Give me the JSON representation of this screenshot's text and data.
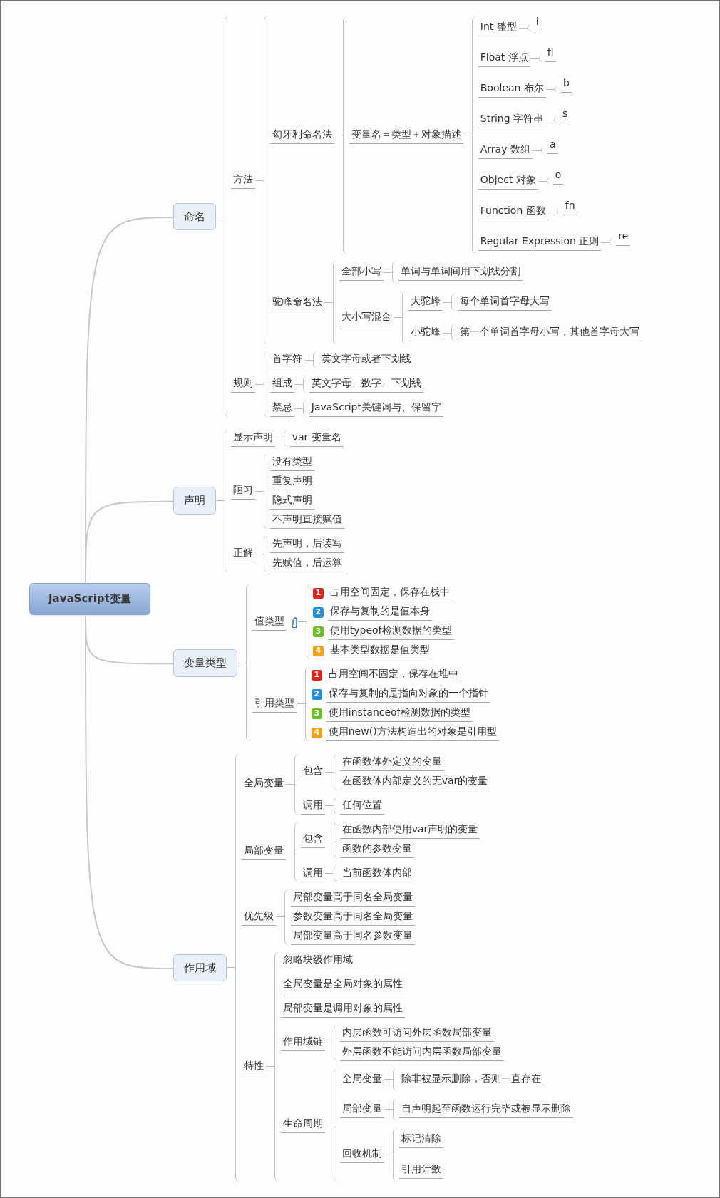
{
  "root": {
    "label": "JavaScript变量"
  },
  "main_topics": [
    {
      "label": "命名",
      "children": [
        {
          "label": "方法",
          "children": [
            {
              "label": "匈牙利命名法",
              "children": [
                {
                  "label": "变量名＝类型＋对象描述",
                  "children": [
                    {
                      "label": "Int 整型",
                      "children": [
                        {
                          "label": "i"
                        }
                      ]
                    },
                    {
                      "label": "Float 浮点",
                      "children": [
                        {
                          "label": "fl"
                        }
                      ]
                    },
                    {
                      "label": "Boolean 布尔",
                      "children": [
                        {
                          "label": "b"
                        }
                      ]
                    },
                    {
                      "label": "String 字符串",
                      "children": [
                        {
                          "label": "s"
                        }
                      ]
                    },
                    {
                      "label": "Array 数组",
                      "children": [
                        {
                          "label": "a"
                        }
                      ]
                    },
                    {
                      "label": "Object 对象",
                      "children": [
                        {
                          "label": "o"
                        }
                      ]
                    },
                    {
                      "label": "Function 函数",
                      "children": [
                        {
                          "label": "fn"
                        }
                      ]
                    },
                    {
                      "label": "Regular Expression 正则",
                      "children": [
                        {
                          "label": "re"
                        }
                      ]
                    }
                  ]
                }
              ]
            },
            {
              "label": "驼峰命名法",
              "children": [
                {
                  "label": "全部小写",
                  "children": [
                    {
                      "label": "单词与单词间用下划线分割"
                    }
                  ]
                },
                {
                  "label": "大小写混合",
                  "children": [
                    {
                      "label": "大驼峰",
                      "children": [
                        {
                          "label": "每个单词首字母大写"
                        }
                      ]
                    },
                    {
                      "label": "小驼峰",
                      "children": [
                        {
                          "label": "第一个单词首字母小写，其他首字母大写"
                        }
                      ]
                    }
                  ]
                }
              ]
            }
          ]
        },
        {
          "label": "规则",
          "children": [
            {
              "label": "首字符",
              "children": [
                {
                  "label": "英文字母或者下划线"
                }
              ]
            },
            {
              "label": "组成",
              "children": [
                {
                  "label": "英文字母、数字、下划线"
                }
              ]
            },
            {
              "label": "禁忌",
              "children": [
                {
                  "label": "JavaScript关键词与、保留字"
                }
              ]
            }
          ]
        }
      ]
    },
    {
      "label": "声明",
      "children": [
        {
          "label": "显示声明",
          "children": [
            {
              "label": "var 变量名"
            }
          ]
        },
        {
          "label": "陋习",
          "children": [
            {
              "label": "没有类型"
            },
            {
              "label": "重复声明"
            },
            {
              "label": "隐式声明"
            },
            {
              "label": "不声明直接赋值"
            }
          ]
        },
        {
          "label": "正解",
          "children": [
            {
              "label": "先声明，后读写"
            },
            {
              "label": "先赋值，后运算"
            }
          ]
        }
      ]
    },
    {
      "label": "变量类型",
      "children": [
        {
          "label": "值类型",
          "attachment": true,
          "children": [
            {
              "label": "占用空间固定，保存在栈中",
              "priority": "1",
              "color": "#d9261c"
            },
            {
              "label": "保存与复制的是值本身",
              "priority": "2",
              "color": "#2b8fd6"
            },
            {
              "label": "使用typeof检测数据的类型",
              "priority": "3",
              "color": "#6cbf26"
            },
            {
              "label": "基本类型数据是值类型",
              "priority": "4",
              "color": "#f0a41a"
            }
          ]
        },
        {
          "label": "引用类型",
          "children": [
            {
              "label": "占用空间不固定，保存在堆中",
              "priority": "1",
              "color": "#d9261c"
            },
            {
              "label": "保存与复制的是指向对象的一个指针",
              "priority": "2",
              "color": "#2b8fd6"
            },
            {
              "label": "使用instanceof检测数据的类型",
              "priority": "3",
              "color": "#6cbf26"
            },
            {
              "label": "使用new()方法构造出的对象是引用型",
              "priority": "4",
              "color": "#f0a41a"
            }
          ]
        }
      ]
    },
    {
      "label": "作用域",
      "children": [
        {
          "label": "全局变量",
          "children": [
            {
              "label": "包含",
              "children": [
                {
                  "label": "在函数体外定义的变量"
                },
                {
                  "label": "在函数体内部定义的无var的变量"
                }
              ]
            },
            {
              "label": "调用",
              "children": [
                {
                  "label": "任何位置"
                }
              ]
            }
          ]
        },
        {
          "label": "局部变量",
          "children": [
            {
              "label": "包含",
              "children": [
                {
                  "label": "在函数内部使用var声明的变量"
                },
                {
                  "label": "函数的参数变量"
                }
              ]
            },
            {
              "label": "调用",
              "children": [
                {
                  "label": "当前函数体内部"
                }
              ]
            }
          ]
        },
        {
          "label": "优先级",
          "children": [
            {
              "label": "局部变量高于同名全局变量"
            },
            {
              "label": "参数变量高于同名全局变量"
            },
            {
              "label": "局部变量高于同名参数变量"
            }
          ]
        },
        {
          "label": "特性",
          "children": [
            {
              "label": "忽略块级作用域"
            },
            {
              "label": "全局变量是全局对象的属性"
            },
            {
              "label": "局部变量是调用对象的属性"
            },
            {
              "label": "作用域链",
              "children": [
                {
                  "label": "内层函数可访问外层函数局部变量"
                },
                {
                  "label": "外层函数不能访问内层函数局部变量"
                }
              ]
            },
            {
              "label": "生命周期",
              "children": [
                {
                  "label": "全局变量",
                  "children": [
                    {
                      "label": "除非被显示删除，否则一直存在"
                    }
                  ]
                },
                {
                  "label": "局部变量",
                  "children": [
                    {
                      "label": "自声明起至函数运行完毕或被显示删除"
                    }
                  ]
                },
                {
                  "label": "回收机制",
                  "children": [
                    {
                      "label": "标记清除"
                    },
                    {
                      "label": "引用计数"
                    }
                  ]
                }
              ]
            }
          ]
        }
      ]
    }
  ]
}
